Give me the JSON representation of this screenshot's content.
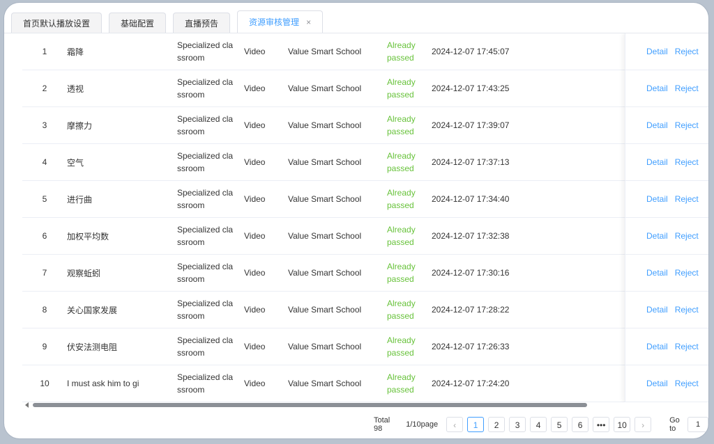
{
  "tabs": [
    {
      "label": "首页默认播放设置",
      "active": false
    },
    {
      "label": "基础配置",
      "active": false
    },
    {
      "label": "直播预告",
      "active": false
    },
    {
      "label": "资源审核管理",
      "active": true
    }
  ],
  "tab_close_glyph": "×",
  "rows": [
    {
      "index": "1",
      "name": "霜降",
      "category": "Specialized classroom",
      "type": "Video",
      "school": "Value Smart School",
      "status": "Already passed",
      "time": "2024-12-07 17:45:07"
    },
    {
      "index": "2",
      "name": "透视",
      "category": "Specialized classroom",
      "type": "Video",
      "school": "Value Smart School",
      "status": "Already passed",
      "time": "2024-12-07 17:43:25"
    },
    {
      "index": "3",
      "name": "摩擦力",
      "category": "Specialized classroom",
      "type": "Video",
      "school": "Value Smart School",
      "status": "Already passed",
      "time": "2024-12-07 17:39:07"
    },
    {
      "index": "4",
      "name": "空气",
      "category": "Specialized classroom",
      "type": "Video",
      "school": "Value Smart School",
      "status": "Already passed",
      "time": "2024-12-07 17:37:13"
    },
    {
      "index": "5",
      "name": "进行曲",
      "category": "Specialized classroom",
      "type": "Video",
      "school": "Value Smart School",
      "status": "Already passed",
      "time": "2024-12-07 17:34:40"
    },
    {
      "index": "6",
      "name": "加权平均数",
      "category": "Specialized classroom",
      "type": "Video",
      "school": "Value Smart School",
      "status": "Already passed",
      "time": "2024-12-07 17:32:38"
    },
    {
      "index": "7",
      "name": "观察蚯蚓",
      "category": "Specialized classroom",
      "type": "Video",
      "school": "Value Smart School",
      "status": "Already passed",
      "time": "2024-12-07 17:30:16"
    },
    {
      "index": "8",
      "name": "关心国家发展",
      "category": "Specialized classroom",
      "type": "Video",
      "school": "Value Smart School",
      "status": "Already passed",
      "time": "2024-12-07 17:28:22"
    },
    {
      "index": "9",
      "name": "伏安法测电阻",
      "category": "Specialized classroom",
      "type": "Video",
      "school": "Value Smart School",
      "status": "Already passed",
      "time": "2024-12-07 17:26:33"
    },
    {
      "index": "10",
      "name": "I must ask him to gi",
      "category": "Specialized classroom",
      "type": "Video",
      "school": "Value Smart School",
      "status": "Already passed",
      "time": "2024-12-07 17:24:20"
    }
  ],
  "actions": {
    "detail": "Detail",
    "reject": "Reject"
  },
  "pagination": {
    "total": "Total 98",
    "page_info": "1/10page",
    "prev_glyph": "‹",
    "next_glyph": "›",
    "pages": [
      "1",
      "2",
      "3",
      "4",
      "5",
      "6",
      "•••",
      "10"
    ],
    "current": "1",
    "goto_label": "Go to",
    "goto_value": "1"
  },
  "colors": {
    "accent": "#409eff",
    "status_passed": "#67c23a"
  }
}
